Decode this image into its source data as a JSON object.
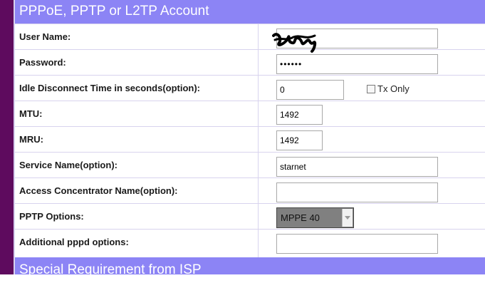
{
  "account": {
    "title": "PPPoE, PPTP or L2TP Account",
    "fields": [
      {
        "label": "User Name:",
        "value": ""
      },
      {
        "label": "Password:",
        "value": "••••••"
      },
      {
        "label": "Idle Disconnect Time in seconds(option):",
        "value": "0"
      },
      {
        "label": "MTU:",
        "value": "1492"
      },
      {
        "label": "MRU:",
        "value": "1492"
      },
      {
        "label": "Service Name(option):",
        "value": "starnet"
      },
      {
        "label": "Access Concentrator Name(option):",
        "value": ""
      },
      {
        "label": "PPTP Options:",
        "value": "MPPE 40"
      },
      {
        "label": "Additional pppd options:",
        "value": ""
      }
    ],
    "tx_only_label": "Tx Only",
    "tx_only_checked": false
  },
  "special": {
    "title": "Special Requirement from ISP"
  },
  "colors": {
    "header_bg": "#8c84f5",
    "left_bar": "#5e0b5e",
    "row_border": "#d8d3ee"
  }
}
